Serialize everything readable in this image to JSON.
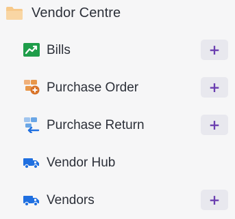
{
  "section": {
    "title": "Vendor Centre",
    "icon": "folder-icon"
  },
  "items": [
    {
      "label": "Bills",
      "icon": "trending-up-icon",
      "has_add": true,
      "add_label": "+"
    },
    {
      "label": "Purchase Order",
      "icon": "purchase-order-icon",
      "has_add": true,
      "add_label": "+"
    },
    {
      "label": "Purchase Return",
      "icon": "purchase-return-icon",
      "has_add": true,
      "add_label": "+"
    },
    {
      "label": "Vendor Hub",
      "icon": "truck-icon",
      "has_add": false
    },
    {
      "label": "Vendors",
      "icon": "truck-icon",
      "has_add": true,
      "add_label": "+"
    }
  ],
  "colors": {
    "background": "#f6f6f7",
    "text": "#2b2f38",
    "add_button_bg": "#e8e8ee",
    "add_button_plus": "#6b3fb0",
    "bills_icon": "#1f9d4a",
    "order_icon": "#e8974a",
    "return_icon": "#6aa6e6",
    "truck_icon": "#1f6fe0"
  }
}
